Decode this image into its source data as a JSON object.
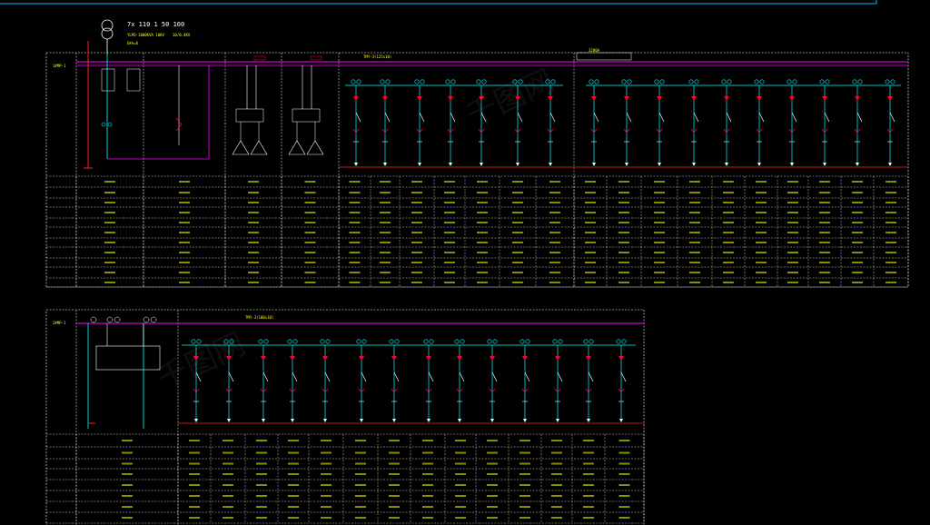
{
  "colors": {
    "background": "#000000",
    "frame": "#00c0ff",
    "busbar": "#ff00ff",
    "feeder": "#00ffff",
    "breaker": "#ff0033",
    "grid": "#ffffff",
    "label": "#ffff00",
    "ground": "#ff2020"
  },
  "transformer": {
    "label": "7x 110 1 50 100",
    "rating": "YLPD-1000KVA 10KV",
    "ratio": "10/0.4KV",
    "impedance": "Uk%=6"
  },
  "diagram1": {
    "row_header": "1#MP-1",
    "busbar_tag": "TMY-3(125x10)",
    "coupler_tag": "3200A"
  },
  "diagram2": {
    "row_header": "2#MP-1",
    "busbar_tag": "TMY-3(100x10)"
  },
  "watermark": "千图网"
}
